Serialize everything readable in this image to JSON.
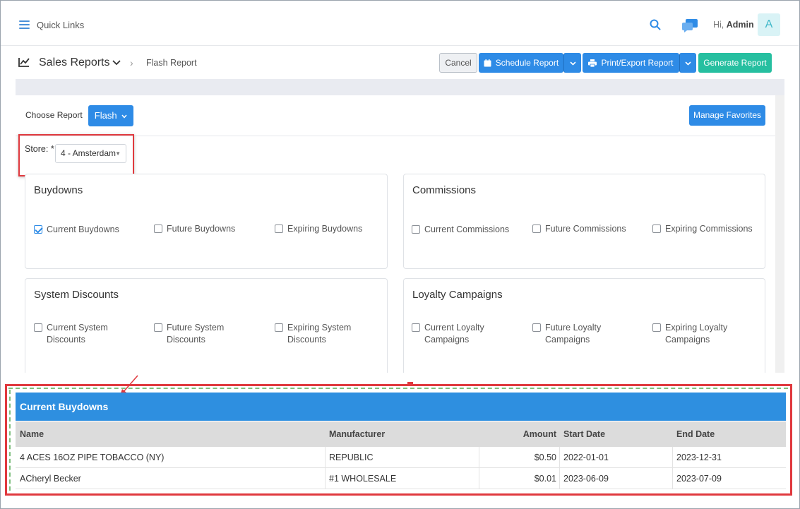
{
  "topbar": {
    "quick_links": "Quick Links",
    "greeting": "Hi,",
    "user": "Admin",
    "avatar_letter": "A"
  },
  "header": {
    "title": "Sales Reports",
    "breadcrumb": "Flash Report",
    "buttons": {
      "cancel": "Cancel",
      "schedule": "Schedule Report",
      "print": "Print/Export Report",
      "generate": "Generate Report"
    }
  },
  "report": {
    "choose_label": "Choose Report",
    "selected": "Flash",
    "manage_favorites": "Manage Favorites",
    "store_label": "Store: *",
    "store_value": "4 - Amsterdam"
  },
  "cards": {
    "buydowns": {
      "title": "Buydowns",
      "options": [
        {
          "label": "Current Buydowns",
          "checked": true
        },
        {
          "label": "Future Buydowns",
          "checked": false
        },
        {
          "label": "Expiring Buydowns",
          "checked": false
        }
      ]
    },
    "commissions": {
      "title": "Commissions",
      "options": [
        {
          "label": "Current Commissions",
          "checked": false
        },
        {
          "label": "Future Commissions",
          "checked": false
        },
        {
          "label": "Expiring Commissions",
          "checked": false
        }
      ]
    },
    "system_discounts": {
      "title": "System Discounts",
      "options": [
        {
          "line1": "Current System",
          "line2": "Discounts",
          "checked": false
        },
        {
          "line1": "Future System",
          "line2": "Discounts",
          "checked": false
        },
        {
          "line1": "Expiring System",
          "line2": "Discounts",
          "checked": false
        }
      ]
    },
    "loyalty": {
      "title": "Loyalty Campaigns",
      "options": [
        {
          "line1": "Current Loyalty",
          "line2": "Campaigns",
          "checked": false
        },
        {
          "line1": "Future Loyalty",
          "line2": "Campaigns",
          "checked": false
        },
        {
          "line1": "Expiring Loyalty",
          "line2": "Campaigns",
          "checked": false
        }
      ]
    }
  },
  "table": {
    "title": "Current Buydowns",
    "columns": [
      "Name",
      "Manufacturer",
      "Amount",
      "Start Date",
      "End Date"
    ],
    "rows": [
      [
        "4 ACES 16OZ PIPE TOBACCO (NY)",
        "REPUBLIC",
        "$0.50",
        "2022-01-01",
        "2023-12-31"
      ],
      [
        "ACheryl Becker",
        "#1 WHOLESALE",
        "$0.01",
        "2023-06-09",
        "2023-07-09"
      ]
    ]
  },
  "colors": {
    "primary": "#2e8be6",
    "generate": "#26bfa0",
    "highlight": "#e0393e",
    "table_header": "#2e8fe0"
  }
}
